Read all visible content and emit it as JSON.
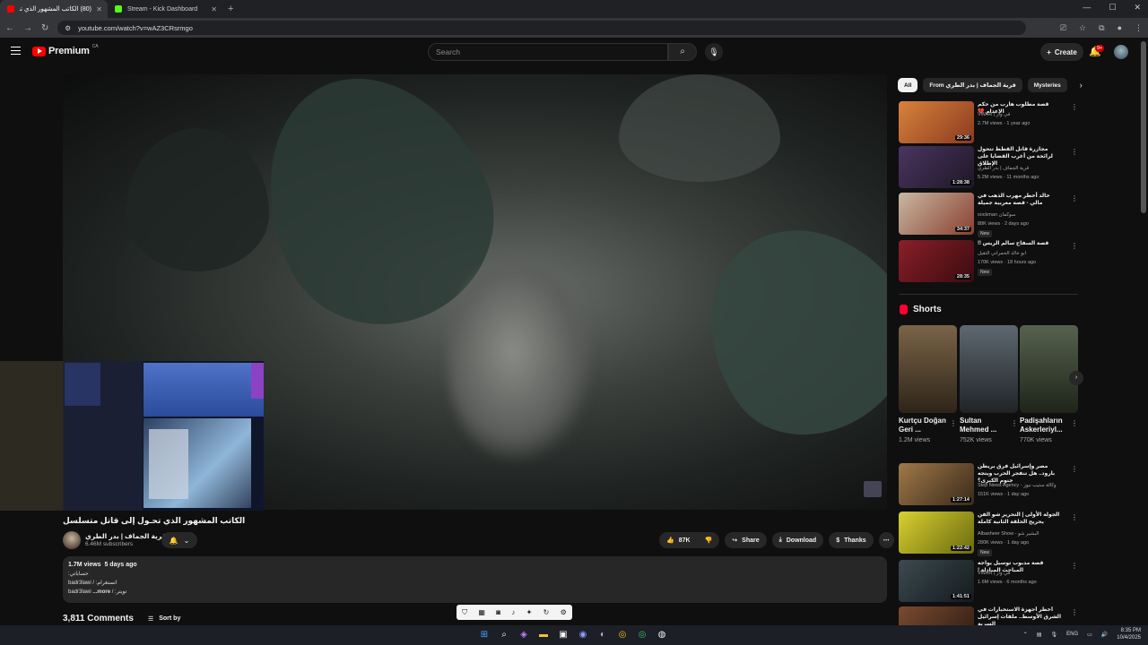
{
  "browser": {
    "tabs": [
      {
        "title": "(80) الكاتب المشهور الذي تحـ",
        "active": true,
        "favicon_color": "#ff0000"
      },
      {
        "title": "Stream - Kick Dashboard",
        "active": false,
        "favicon_color": "#53fc18"
      }
    ],
    "new_tab": "+",
    "url": "youtube.com/watch?v=wAZ3CRsrmgo"
  },
  "header": {
    "logo": "Premium",
    "logo_region": "CA",
    "search_placeholder": "Search",
    "create_label": "Create",
    "notif_count": "9+"
  },
  "video": {
    "title": "الكاتب المشهور الذي تحـول إلى قاتل متسلسل",
    "channel": "قرية الجماف | بدر الطري",
    "subscribers": "6.46M subscribers",
    "likes": "87K",
    "share_label": "Share",
    "download_label": "Download",
    "thanks_label": "Thanks",
    "views": "1.7M views",
    "age": "5 days ago",
    "desc_lines": [
      "حساباتي:",
      "انستغرام: / badr3lawi",
      "تويتر: / badr3lawi"
    ],
    "more_label": "...more"
  },
  "comments": {
    "count": "3,811 Comments",
    "sort_label": "Sort by"
  },
  "chips": [
    "All",
    "From قرية الجماف | بدر الطري",
    "Mysteries"
  ],
  "recommendations": [
    {
      "title": "قصة مطلوب هارب من حكم الإعدام 💔",
      "channel": "VWAR | في وار",
      "meta": "2.7M views · 1 year ago",
      "duration": "29:36",
      "new": false,
      "thumb_color": "#b5662f"
    },
    {
      "title": "مجازرة قاتل القطط تتحول لرائحة من أغرب القضايا على الإطلاق",
      "channel": "قرية الجماف | بدر الطري",
      "meta": "5.2M views · 11 months ago",
      "duration": "1:28:38",
      "new": false,
      "thumb_color": "#3b2a4a"
    },
    {
      "title": "خالد أخطر مهرب الذهب في مالي - قصة مغربية جميلة",
      "channel": "sockman سوكمان",
      "meta": "88K views · 2 days ago",
      "duration": "34:37",
      "new": true,
      "thumb_color": "#8a3f2f"
    },
    {
      "title": "قصة السفاح سالم الريس !!",
      "channel": "ابو خالد الحمراني التقيل",
      "meta": "170K views · 18 hours ago",
      "duration": "28:35",
      "new": true,
      "thumb_color": "#6b1c22"
    }
  ],
  "shorts": {
    "heading": "Shorts",
    "items": [
      {
        "title": "Kurtçu Doğan Geri ...",
        "views": "1.2M views",
        "color": "#5a4a35"
      },
      {
        "title": "Sultan Mehmed ...",
        "views": "752K views",
        "color": "#4b5158"
      },
      {
        "title": "Padişahların Askerleriyl...",
        "views": "770K views",
        "color": "#3f4a3a"
      }
    ]
  },
  "recommendations2": [
    {
      "title": "مصر وإسرائيل فرق بريطن بارود.. هل تنفجر الحرب ويتجه جنوم الكبرى؟",
      "channel": "Step News Agency - وكالة ستيب نيوز",
      "meta": "151K views · 1 day ago",
      "duration": "1:27:14",
      "new": false,
      "thumb_color": "#7a5a3a"
    },
    {
      "title": "الجولة الأولى | التحرير شو الفن يحريح الحلقة الثانية كاملة",
      "channel": "Albasheer Show - البشير شو",
      "meta": "280K views · 1 day ago",
      "duration": "1:22:42",
      "new": true,
      "thumb_color": "#c9c023"
    },
    {
      "title": "قصة مدبوب توسيل يواجه المباحث المبادلة !",
      "channel": "VWAR | في وار",
      "meta": "1.6M views · 6 months ago",
      "duration": "1:41:51",
      "new": false,
      "thumb_color": "#2f3a3f"
    },
    {
      "title": "أخطر أجهزة الاستخبارات في الشرق الأوسط.. ملفات إسرائيل السرية",
      "channel": "",
      "meta": "",
      "duration": "",
      "new": false,
      "thumb_color": "#5a3a2a"
    }
  ],
  "taskbar": {
    "lang": "ENG",
    "time": "8:35 PM",
    "date": "10/4/2025"
  }
}
